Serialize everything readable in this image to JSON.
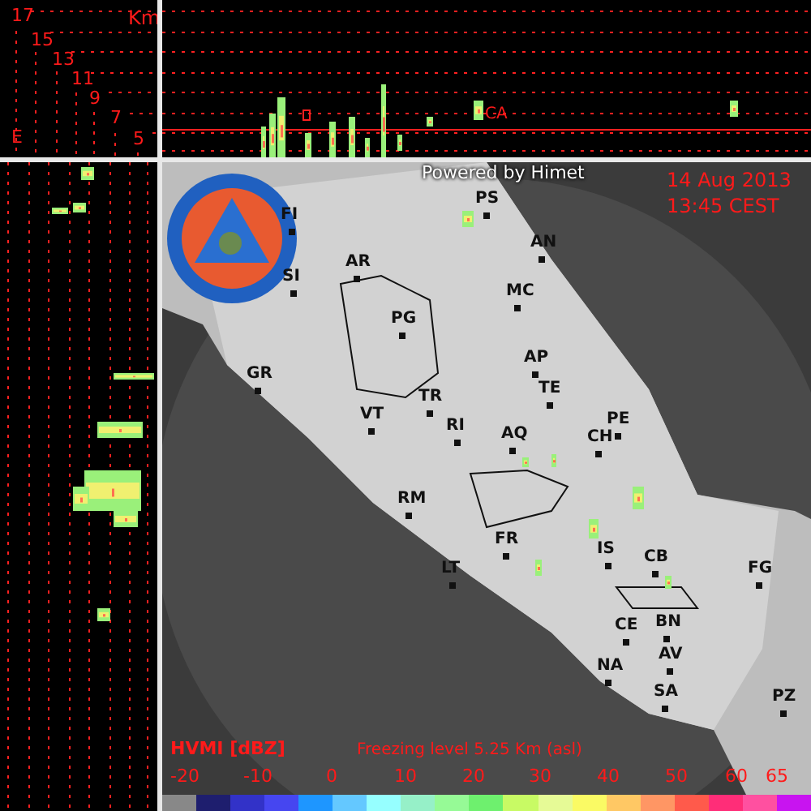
{
  "height_panel": {
    "unit": "Km",
    "labels": [
      "17",
      "15",
      "13",
      "11",
      "9",
      "7",
      "5"
    ],
    "axis_letter": "E"
  },
  "profile": {
    "site_label": "CA"
  },
  "map": {
    "credit": "Powered by Himet",
    "date": "14 Aug 2013",
    "time": "13:45 CEST",
    "cities": [
      {
        "name": "PS"
      },
      {
        "name": "FI"
      },
      {
        "name": "AN"
      },
      {
        "name": "AR"
      },
      {
        "name": "SI"
      },
      {
        "name": "MC"
      },
      {
        "name": "PG"
      },
      {
        "name": "GR"
      },
      {
        "name": "AP"
      },
      {
        "name": "TE"
      },
      {
        "name": "TR"
      },
      {
        "name": "VT"
      },
      {
        "name": "RI"
      },
      {
        "name": "AQ"
      },
      {
        "name": "PE"
      },
      {
        "name": "CH"
      },
      {
        "name": "RM"
      },
      {
        "name": "FR"
      },
      {
        "name": "LT"
      },
      {
        "name": "IS"
      },
      {
        "name": "CB"
      },
      {
        "name": "FG"
      },
      {
        "name": "CE"
      },
      {
        "name": "BN"
      },
      {
        "name": "AV"
      },
      {
        "name": "NA"
      },
      {
        "name": "SA"
      },
      {
        "name": "PZ"
      }
    ]
  },
  "legend": {
    "title": "HVMI [dBZ]",
    "freezing_level": "Freezing level  5.25 Km (asl)",
    "ticks": [
      "-20",
      "-10",
      "0",
      "10",
      "20",
      "30",
      "40",
      "50",
      "60",
      "65"
    ],
    "swatches": [
      {
        "color": "#888888"
      },
      {
        "color": "#1e1e6e"
      },
      {
        "color": "#3232c8"
      },
      {
        "color": "#4646f0"
      },
      {
        "color": "#1e96ff"
      },
      {
        "color": "#64c8ff"
      },
      {
        "color": "#96ffff"
      },
      {
        "color": "#96f0c8"
      },
      {
        "color": "#96fa96"
      },
      {
        "color": "#6ef06e"
      },
      {
        "color": "#c8fa64"
      },
      {
        "color": "#e6fa96"
      },
      {
        "color": "#fafa64"
      },
      {
        "color": "#ffc864"
      },
      {
        "color": "#ff9664"
      },
      {
        "color": "#ff5a4b"
      },
      {
        "color": "#ff2d78"
      },
      {
        "color": "#ff50a0"
      },
      {
        "color": "#c814f0"
      }
    ]
  }
}
